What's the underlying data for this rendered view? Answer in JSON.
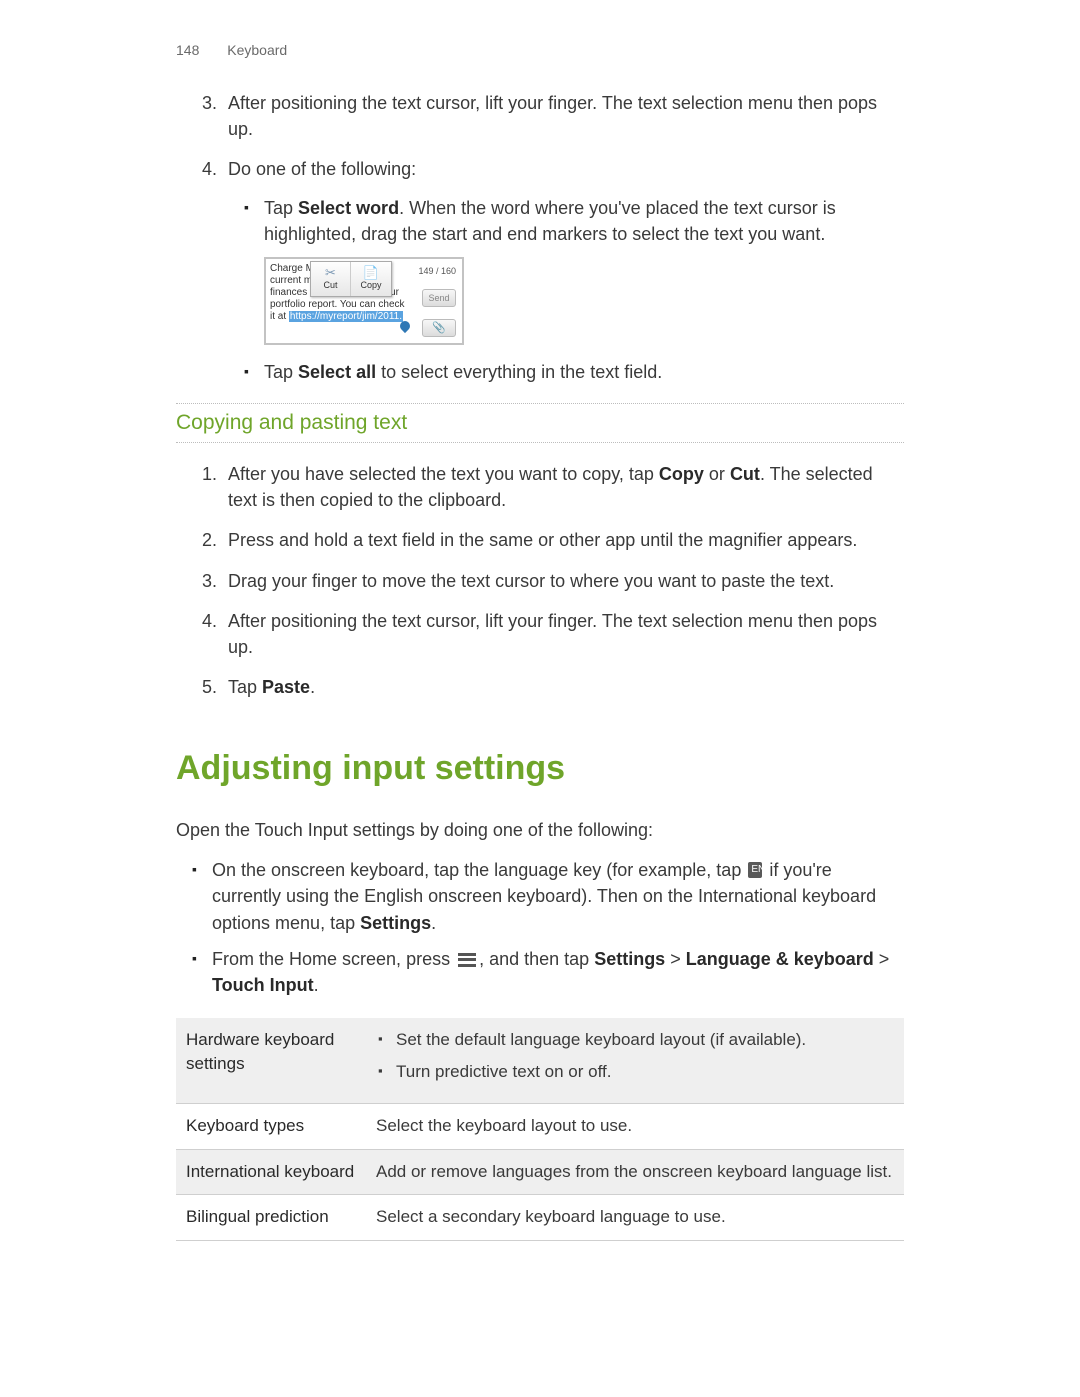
{
  "header": {
    "page_number": "148",
    "section": "Keyboard"
  },
  "steps_a": [
    {
      "n": "3",
      "text_a": "After positioning the text cursor, lift your finger. The text selection menu then pops up."
    },
    {
      "n": "4",
      "text_a": "Do one of the following:"
    }
  ],
  "sub_a": {
    "item1_pre": "Tap ",
    "item1_bold": "Select word",
    "item1_post": ". When the word where you've placed the text cursor is highlighted, drag the start and end markers to select the text you want.",
    "item2_pre": "Tap ",
    "item2_bold": "Select all",
    "item2_post": " to select everything in the text field."
  },
  "mock": {
    "body_line1": "Charge Mr. Walker for the",
    "body_line2": "current market price. Your",
    "body_line3_a": "finances are on track on your",
    "body_line4": "portfolio report. You can check",
    "body_line5_a": "it at ",
    "body_line5_hl": "https://myreport/jim/2011.",
    "counter": "149 / 160",
    "cut": "Cut",
    "copy": "Copy",
    "send": "Send",
    "attach": "📎"
  },
  "section_title": "Copying and pasting text",
  "steps_b": [
    {
      "pre": "After you have selected the text you want to copy, tap ",
      "b1": "Copy",
      "mid": " or ",
      "b2": "Cut",
      "post": ". The selected text is then copied to the clipboard."
    },
    {
      "pre": "Press and hold a text field in the same or other app until the magnifier appears.",
      "b1": "",
      "mid": "",
      "b2": "",
      "post": ""
    },
    {
      "pre": "Drag your finger to move the text cursor to where you want to paste the text.",
      "b1": "",
      "mid": "",
      "b2": "",
      "post": ""
    },
    {
      "pre": "After positioning the text cursor, lift your finger. The text selection menu then pops up.",
      "b1": "",
      "mid": "",
      "b2": "",
      "post": ""
    },
    {
      "pre": "Tap ",
      "b1": "Paste",
      "mid": ".",
      "b2": "",
      "post": ""
    }
  ],
  "h1": "Adjusting input settings",
  "intro": "Open the Touch Input settings by doing one of the following:",
  "bullets_c": {
    "b1_pre": "On the onscreen keyboard, tap the language key (for example, tap ",
    "b1_post": " if you're currently using the English onscreen keyboard). Then on the International keyboard options menu, tap ",
    "b1_bold": "Settings",
    "b1_end": ".",
    "b2_pre": "From the Home screen, press ",
    "b2_mid": ", and then tap ",
    "b2_bold1": "Settings",
    "b2_gt1": " > ",
    "b2_bold2": "Language & keyboard",
    "b2_gt2": " > ",
    "b2_bold3": "Touch Input",
    "b2_end": "."
  },
  "table": {
    "r1_label": "Hardware keyboard settings",
    "r1_li1": "Set the default language keyboard layout (if available).",
    "r1_li2": "Turn predictive text on or off.",
    "r2_label": "Keyboard types",
    "r2_val": "Select the keyboard layout to use.",
    "r3_label": "International keyboard",
    "r3_val": "Add or remove languages from the onscreen keyboard language list.",
    "r4_label": "Bilingual prediction",
    "r4_val": "Select a secondary keyboard language to use."
  }
}
